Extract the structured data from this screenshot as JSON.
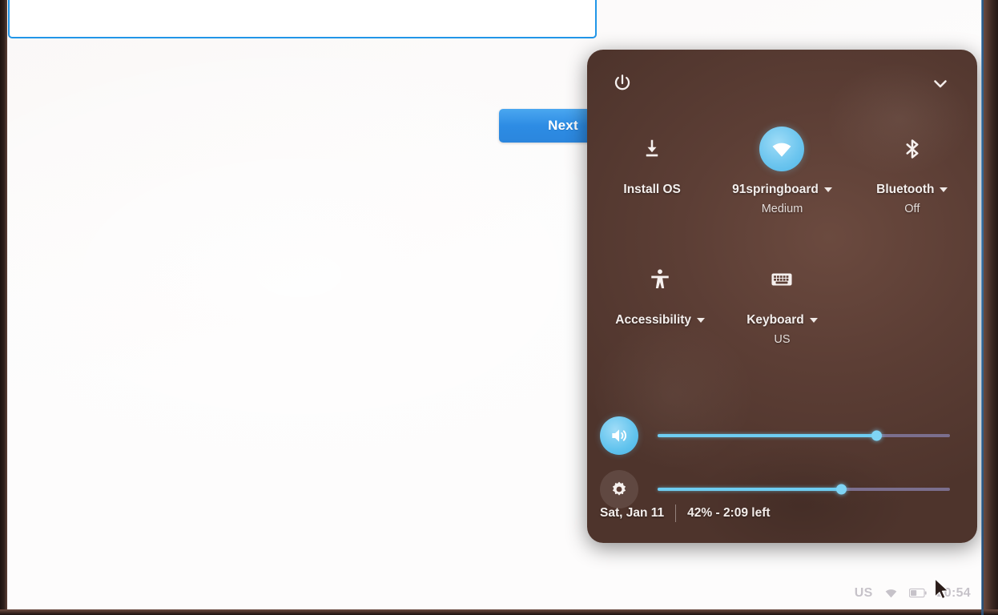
{
  "setup_page": {
    "input": {
      "value": "",
      "placeholder": ""
    },
    "next_button_label": "Next"
  },
  "quick_settings": {
    "power_icon": "power-icon",
    "collapse_icon": "chevron-down-icon",
    "toggles": [
      {
        "icon": "install-download-icon",
        "label": "Install OS",
        "sublabel": "",
        "has_caret": false,
        "active": false
      },
      {
        "icon": "wifi-icon",
        "label": "91springboard",
        "sublabel": "Medium",
        "has_caret": true,
        "active": true
      },
      {
        "icon": "bluetooth-icon",
        "label": "Bluetooth",
        "sublabel": "Off",
        "has_caret": true,
        "active": false
      },
      {
        "icon": "accessibility-icon",
        "label": "Accessibility",
        "sublabel": "",
        "has_caret": true,
        "active": false
      },
      {
        "icon": "keyboard-icon",
        "label": "Keyboard",
        "sublabel": "US",
        "has_caret": true,
        "active": false
      }
    ],
    "sliders": [
      {
        "name": "volume",
        "icon": "volume-up-icon",
        "value_percent": 75,
        "active": true
      },
      {
        "name": "brightness",
        "icon": "brightness-icon",
        "value_percent": 63,
        "active": false
      }
    ],
    "footer": {
      "date": "Sat, Jan 11",
      "battery": "42% - 2:09 left"
    }
  },
  "system_tray": {
    "locale": "US",
    "wifi_icon": "wifi-icon",
    "battery_icon": "battery-icon",
    "clock": "20:54"
  },
  "colors": {
    "panel_bg": "#5c3e35",
    "accent_blue": "#6ecdf2",
    "button_blue": "#2d8ce4",
    "input_border": "#2196e8",
    "page_bg": "#fdfcfc"
  }
}
